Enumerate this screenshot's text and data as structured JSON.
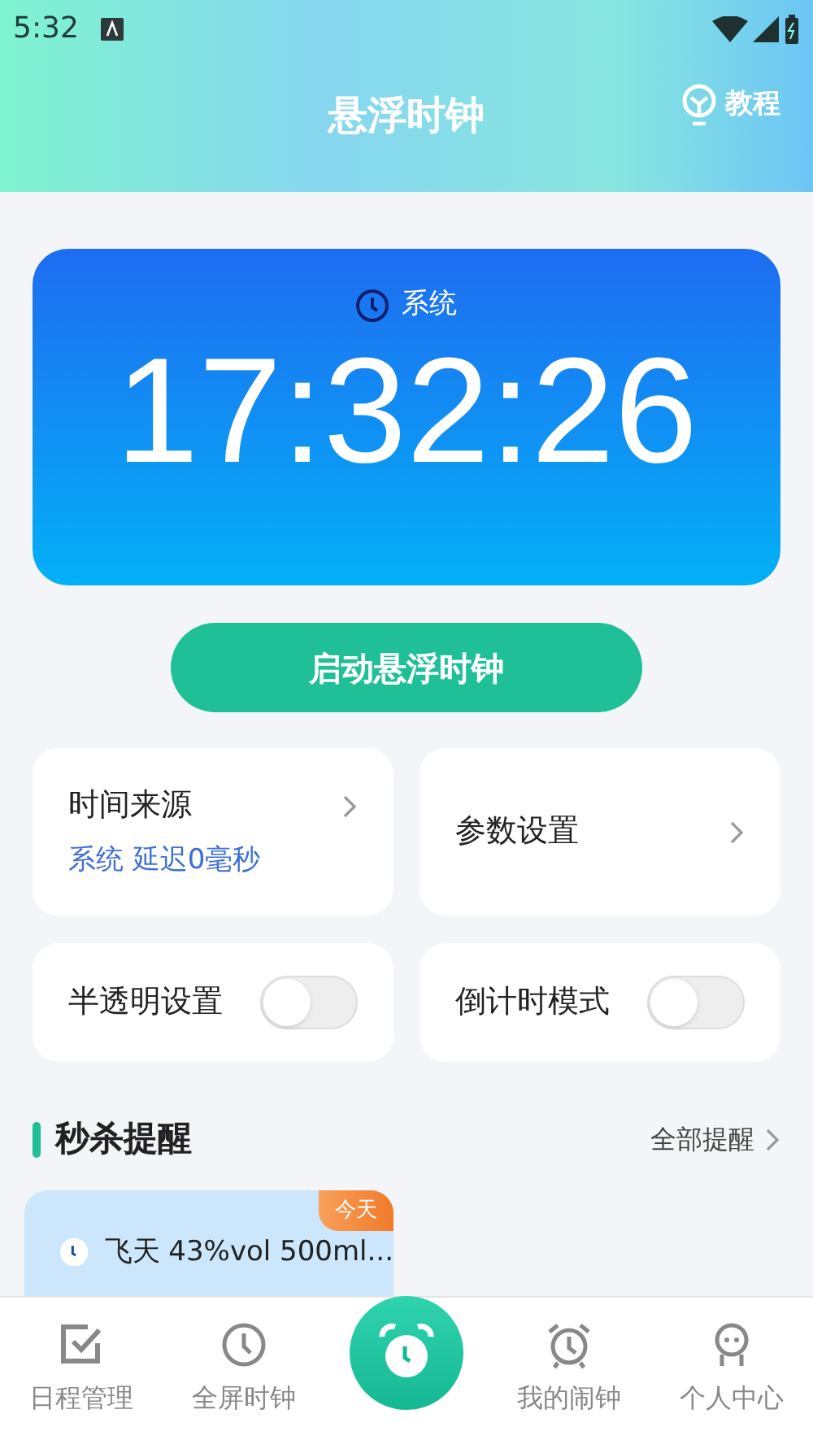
{
  "status_bar": {
    "time": "5:32"
  },
  "header": {
    "title": "悬浮时钟",
    "action": "教程"
  },
  "clock": {
    "source": "系统",
    "time": "17:32:26"
  },
  "start_button": "启动悬浮时钟",
  "settings": [
    {
      "kind": "link",
      "label": "时间来源",
      "detail": "系统 延迟0毫秒"
    },
    {
      "kind": "link",
      "label": "参数设置"
    },
    {
      "kind": "toggle",
      "label": "半透明设置",
      "on": false
    },
    {
      "kind": "toggle",
      "label": "倒计时模式",
      "on": false
    }
  ],
  "section": {
    "title": "秒杀提醒",
    "more": "全部提醒"
  },
  "reminders": [
    {
      "badge": "今天",
      "title": "飞天 43%vol 500ml..."
    }
  ],
  "bottom_nav": [
    {
      "kind": "tab",
      "label": "日程管理"
    },
    {
      "kind": "tab",
      "label": "全屏时钟"
    },
    {
      "kind": "fab"
    },
    {
      "kind": "tab",
      "label": "我的闹钟"
    },
    {
      "kind": "tab",
      "label": "个人中心"
    }
  ]
}
